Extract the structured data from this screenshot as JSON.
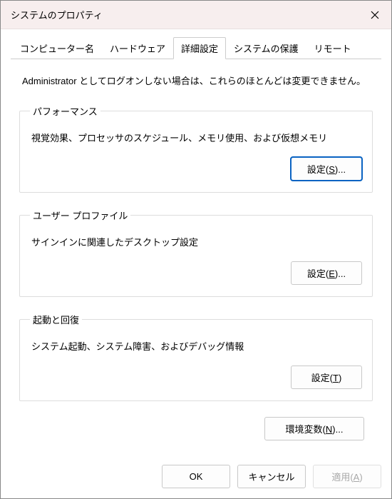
{
  "window": {
    "title": "システムのプロパティ"
  },
  "tabs": {
    "computer_name": "コンピューター名",
    "hardware": "ハードウェア",
    "advanced": "詳細設定",
    "protection": "システムの保護",
    "remote": "リモート"
  },
  "intro": "Administrator としてログオンしない場合は、これらのほとんどは変更できません。",
  "performance": {
    "legend": "パフォーマンス",
    "desc": "視覚効果、プロセッサのスケジュール、メモリ使用、および仮想メモリ",
    "button_prefix": "設定(",
    "button_accel": "S",
    "button_suffix": ")..."
  },
  "profiles": {
    "legend": "ユーザー プロファイル",
    "desc": "サインインに関連したデスクトップ設定",
    "button_prefix": "設定(",
    "button_accel": "E",
    "button_suffix": ")..."
  },
  "startup": {
    "legend": "起動と回復",
    "desc": "システム起動、システム障害、およびデバッグ情報",
    "button_prefix": "設定(",
    "button_accel": "T",
    "button_suffix": ")"
  },
  "env": {
    "button_prefix": "環境変数(",
    "button_accel": "N",
    "button_suffix": ")..."
  },
  "footer": {
    "ok": "OK",
    "cancel": "キャンセル",
    "apply_prefix": "適用(",
    "apply_accel": "A",
    "apply_suffix": ")"
  }
}
